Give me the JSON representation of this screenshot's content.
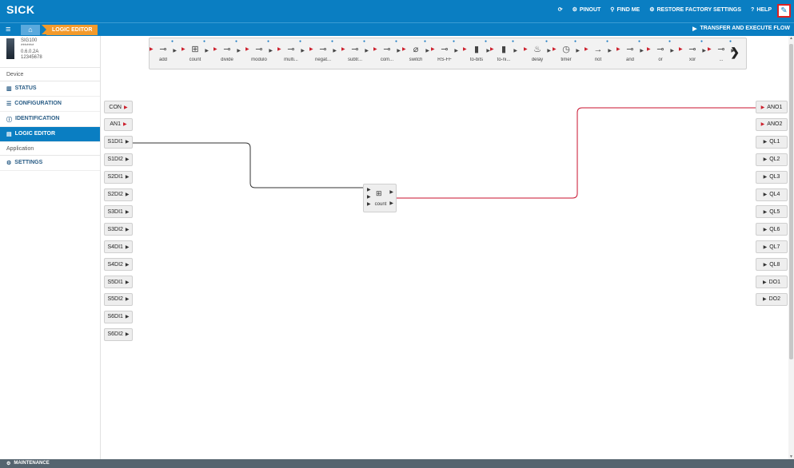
{
  "app": {
    "logo": "SICK"
  },
  "header": {
    "menu": [
      {
        "icon": "refresh-icon",
        "glyph": "⟳",
        "label": ""
      },
      {
        "icon": "pinout-icon",
        "glyph": "⚙",
        "label": "PINOUT"
      },
      {
        "icon": "search-icon",
        "glyph": "⚲",
        "label": "FIND ME"
      },
      {
        "icon": "restore-icon",
        "glyph": "⚙",
        "label": "RESTORE FACTORY SETTINGS"
      },
      {
        "icon": "help-icon",
        "glyph": "?",
        "label": "HELP"
      }
    ],
    "edit_glyph": "✎"
  },
  "subbar": {
    "menu_glyph": "≡",
    "home_glyph": "⌂",
    "breadcrumb": "LOGIC EDITOR",
    "transfer_label": "TRANSFER AND EXECUTE FLOW",
    "transfer_glyph": "▶"
  },
  "device": {
    "name": "SIG100",
    "mask": "*******",
    "version": "0.6.0.2A",
    "serial": "12345678"
  },
  "sidebar": {
    "device_heading": "Device",
    "device_items": [
      {
        "name": "status",
        "glyph": "▥",
        "label": "STATUS"
      },
      {
        "name": "configuration",
        "glyph": "☰",
        "label": "CONFIGURATION"
      },
      {
        "name": "identification",
        "glyph": "ⓘ",
        "label": "IDENTIFICATION"
      },
      {
        "name": "logic-editor",
        "glyph": "▤",
        "label": "LOGIC EDITOR",
        "active": true
      }
    ],
    "application_heading": "Application",
    "application_items": [
      {
        "name": "settings",
        "glyph": "⚙",
        "label": "SETTINGS"
      }
    ]
  },
  "palette": [
    {
      "name": "add",
      "glyph": "⊸",
      "label": "add"
    },
    {
      "name": "count",
      "glyph": "⊞",
      "label": "count"
    },
    {
      "name": "divide",
      "glyph": "⊸",
      "label": "divide"
    },
    {
      "name": "modulo",
      "glyph": "⊸",
      "label": "modulo"
    },
    {
      "name": "multiply",
      "glyph": "⊸",
      "label": "multi..."
    },
    {
      "name": "negate",
      "glyph": "⊸",
      "label": "negat..."
    },
    {
      "name": "subtract",
      "glyph": "⊸",
      "label": "subtr..."
    },
    {
      "name": "compare",
      "glyph": "⊸",
      "label": "com..."
    },
    {
      "name": "switch",
      "glyph": "⌀",
      "label": "switch"
    },
    {
      "name": "rs-ff",
      "glyph": "⊸",
      "label": "RS-FF"
    },
    {
      "name": "to-bits",
      "glyph": "▮",
      "label": "to-bits"
    },
    {
      "name": "to-nibble",
      "glyph": "▮",
      "label": "to-ni..."
    },
    {
      "name": "delay",
      "glyph": "♨",
      "label": "delay"
    },
    {
      "name": "timer",
      "glyph": "◷",
      "label": "timer"
    },
    {
      "name": "not",
      "glyph": "→",
      "label": "not"
    },
    {
      "name": "and",
      "glyph": "⊸",
      "label": "and"
    },
    {
      "name": "or",
      "glyph": "⊸",
      "label": "or"
    },
    {
      "name": "xor",
      "glyph": "⊸",
      "label": "xor"
    },
    {
      "name": "more",
      "glyph": "⊸",
      "label": "..."
    }
  ],
  "palette_next_glyph": "❯",
  "inputs": [
    "CON",
    "AN1",
    "S1DI1",
    "S1DI2",
    "S2DI1",
    "S2DI2",
    "S3DI1",
    "S3DI2",
    "S4DI1",
    "S4DI2",
    "S5DI1",
    "S5DI2",
    "S6DI1",
    "S6DI2"
  ],
  "outputs": [
    "ANO1",
    "ANO2",
    "QL1",
    "QL2",
    "QL3",
    "QL4",
    "QL5",
    "QL6",
    "QL7",
    "QL8",
    "DO1",
    "DO2"
  ],
  "canvas_block": {
    "label": "count",
    "glyph": "⊞"
  },
  "footer": {
    "label": "MAINTENANCE",
    "glyph": "⚙"
  }
}
